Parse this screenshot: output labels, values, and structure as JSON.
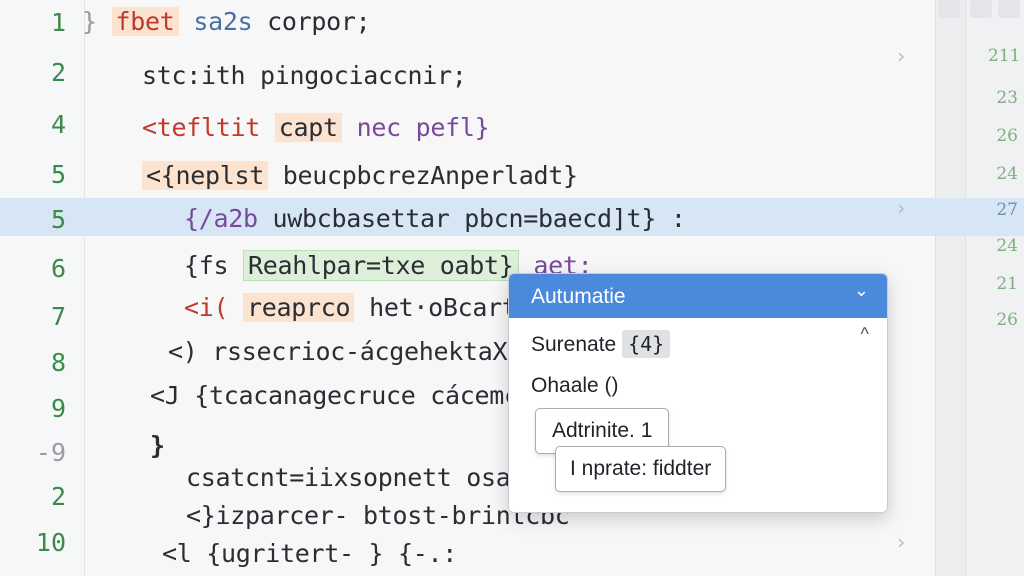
{
  "line_numbers": [
    "1",
    "2",
    "4",
    "5",
    "5",
    "6",
    "7",
    "8",
    "9",
    "-9",
    "2",
    "10"
  ],
  "code": {
    "l1": {
      "brace": "}",
      "kw": "fbet",
      "ty": "sa2s",
      "rest": "corpor;"
    },
    "l2": {
      "text": "stc:ith pingociaccnir;"
    },
    "l3": {
      "lead": "<tefltit",
      "chip": "capt",
      "rest": "nec pefl}"
    },
    "l4": {
      "lead": "<{neplst",
      "rest": "beucpbcrezAnperladt}"
    },
    "l5": {
      "lead": "{/a2b",
      "rest": "uwbcbasettar pbcn=baecd]t} :"
    },
    "l6": {
      "lead": "{fs",
      "chip": "Reahlpar=txe oabt}",
      "rest": "aet:"
    },
    "l7": {
      "lead": "<i(",
      "chip": "reaprco",
      "rest": "het·oBcartn"
    },
    "l8": {
      "text": "<) rssecrioc-ácgehektaXenn"
    },
    "l9": {
      "text": "<J {tcacanagecruce cácemc"
    },
    "l10": {
      "text": "}"
    },
    "l11": {
      "text": "csatcnt=iixsopnett osarb;"
    },
    "l12": {
      "text": "<}izparcer- btost-brintcbc"
    },
    "l13": {
      "text": "<l {ugritert- } {-.:"
    }
  },
  "minimap_numbers": [
    "211",
    "23",
    "26",
    "24",
    "27",
    "24",
    "21",
    "26"
  ],
  "autocomplete": {
    "selected": "Autumatie",
    "items": [
      {
        "label": "Surenate",
        "badge": "{4}"
      },
      {
        "label": "Ohaale ()"
      }
    ],
    "buttons": [
      "Adtrinite. 1",
      "I nprate: fiddter"
    ]
  },
  "colors": {
    "accent": "#4a89dc",
    "line_highlight": "#d6e6f5",
    "line_number": "#3a8a4a"
  }
}
